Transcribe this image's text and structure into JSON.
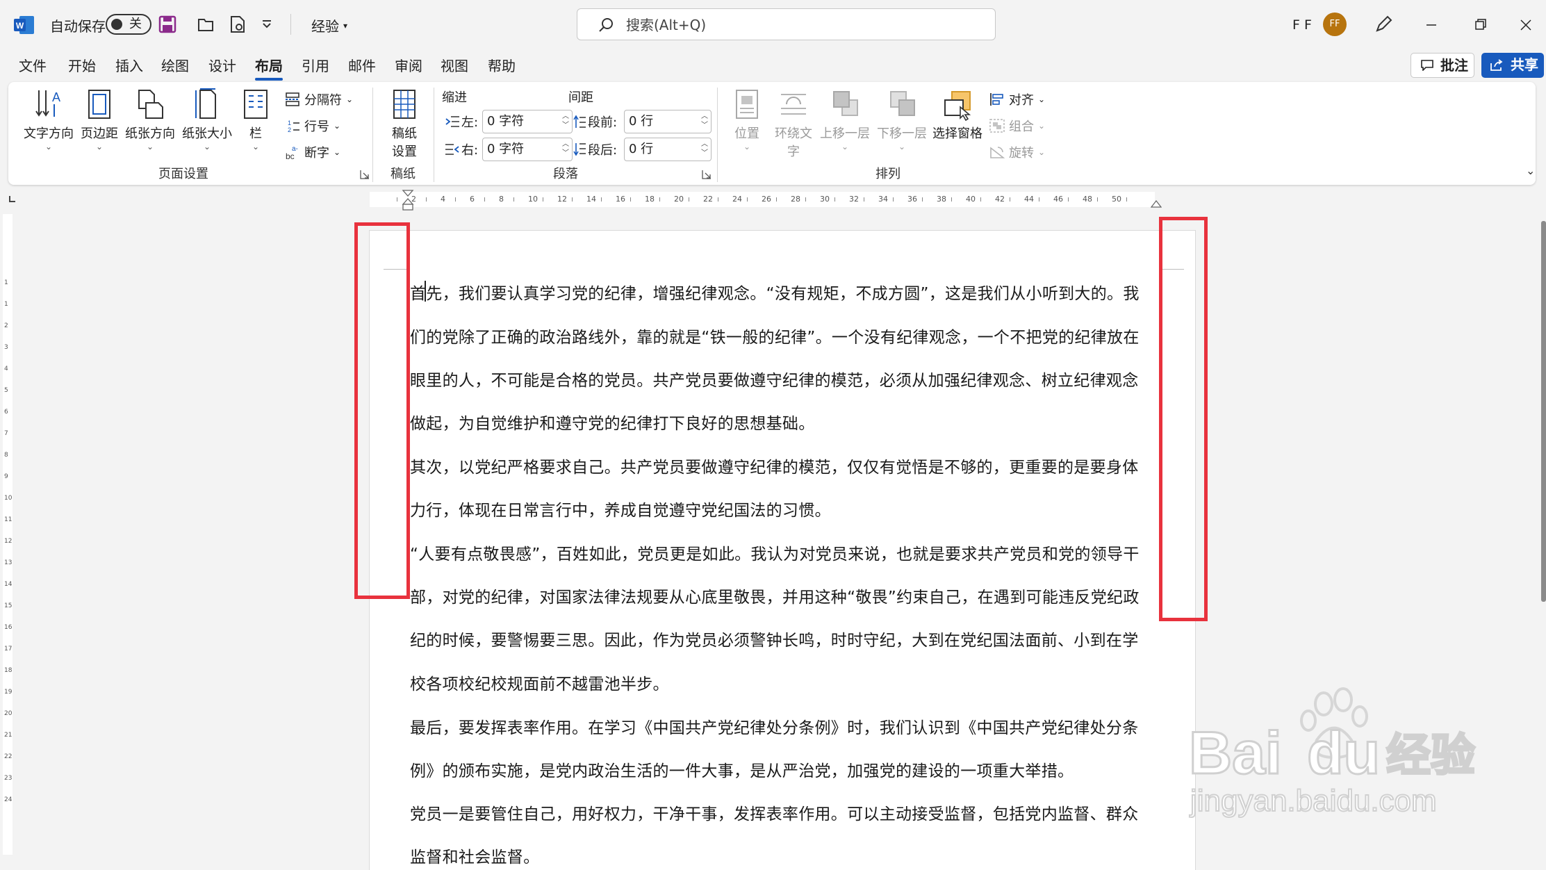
{
  "titlebar": {
    "autosave_label": "自动保存",
    "autosave_state": "关",
    "doc_title": "经验",
    "search_placeholder": "搜索(Alt+Q)",
    "user_initials": "F F",
    "avatar_initials": "FF"
  },
  "menu": {
    "tabs": [
      "文件",
      "开始",
      "插入",
      "绘图",
      "设计",
      "布局",
      "引用",
      "邮件",
      "审阅",
      "视图",
      "帮助"
    ],
    "active_tab": "布局",
    "comments_label": "批注",
    "share_label": "共享"
  },
  "ribbon": {
    "page_setup": {
      "group_label": "页面设置",
      "text_direction": "文字方向",
      "margins": "页边距",
      "orientation": "纸张方向",
      "size": "纸张大小",
      "columns": "栏",
      "breaks": "分隔符",
      "line_numbers": "行号",
      "hyphenation": "断字"
    },
    "manuscript": {
      "group_label": "稿纸",
      "settings_line1": "稿纸",
      "settings_line2": "设置"
    },
    "paragraph": {
      "group_label": "段落",
      "indent_header": "缩进",
      "spacing_header": "间距",
      "left_label": "左:",
      "left_value": "0 字符",
      "right_label": "右:",
      "right_value": "0 字符",
      "before_label": "段前:",
      "before_value": "0 行",
      "after_label": "段后:",
      "after_value": "0 行"
    },
    "arrange": {
      "group_label": "排列",
      "position": "位置",
      "wrap_text_line1": "环绕文",
      "wrap_text_line2": "字",
      "bring_forward": "上移一层",
      "send_backward": "下移一层",
      "selection_pane": "选择窗格",
      "align": "对齐",
      "group": "组合",
      "rotate": "旋转"
    }
  },
  "ruler": {
    "h_numbers": [
      "2",
      "4",
      "6",
      "8",
      "10",
      "12",
      "14",
      "16",
      "18",
      "20",
      "22",
      "24",
      "26",
      "28",
      "30",
      "32",
      "34",
      "36",
      "38",
      "40",
      "42",
      "44",
      "46",
      "48",
      "50"
    ],
    "v_numbers": [
      "1",
      "1",
      "2",
      "3",
      "4",
      "5",
      "6",
      "7",
      "8",
      "9",
      "10",
      "11",
      "12",
      "13",
      "14",
      "15",
      "16",
      "17",
      "18",
      "19",
      "20",
      "21",
      "22",
      "23",
      "24"
    ]
  },
  "document": {
    "lines": [
      "首先，我们要认真学习党的纪律，增强纪律观念。“没有规矩，不成方圆”，这是我们从小听到大的。我",
      "们的党除了正确的政治路线外，靠的就是“铁一般的纪律”。一个没有纪律观念，一个不把党的纪律放在",
      "眼里的人，不可能是合格的党员。共产党员要做遵守纪律的模范，必须从加强纪律观念、树立纪律观念",
      "做起，为自觉维护和遵守党的纪律打下良好的思想基础。",
      "其次，以党纪严格要求自己。共产党员要做遵守纪律的模范，仅仅有觉悟是不够的，更重要的是要身体",
      "力行，体现在日常言行中，养成自觉遵守党纪国法的习惯。",
      "“人要有点敬畏感”，百姓如此，党员更是如此。我认为对党员来说，也就是要求共产党员和党的领导干",
      "部，对党的纪律，对国家法律法规要从心底里敬畏，并用这种“敬畏”约束自己，在遇到可能违反党纪政",
      "纪的时候，要警惕要三思。因此，作为党员必须警钟长鸣，时时守纪，大到在党纪国法面前、小到在学",
      "校各项校纪校规面前不越雷池半步。",
      "最后，要发挥表率作用。在学习《中国共产党纪律处分条例》时，我们认识到《中国共产党纪律处分条",
      "例》的颁布实施，是党内政治生活的一件大事，是从严治党，加强党的建设的一项重大举措。",
      "党员一是要管住自己，用好权力，干净干事，发挥表率作用。可以主动接受监督，包括党内监督、群众",
      "监督和社会监督。"
    ]
  },
  "watermark": {
    "brand": "Bai",
    "brand_cn": "经验",
    "url": "jingyan.baidu.com"
  },
  "colors": {
    "accent": "#185abd",
    "highlight": "#e8323d",
    "avatar": "#b7740e"
  }
}
